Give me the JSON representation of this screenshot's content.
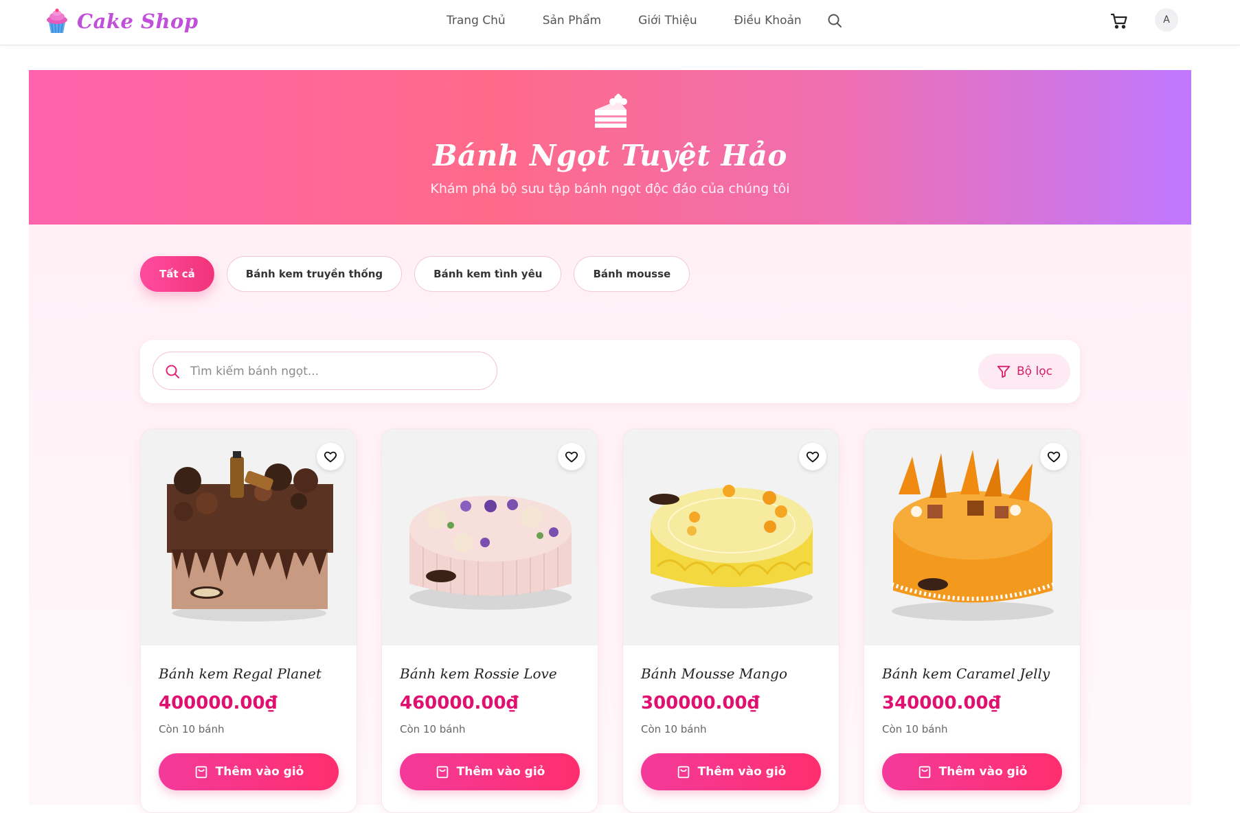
{
  "brand": {
    "name": "Cake Shop"
  },
  "nav": {
    "items": [
      {
        "label": "Trang Chủ"
      },
      {
        "label": "Sản Phẩm"
      },
      {
        "label": "Giới Thiệu"
      },
      {
        "label": "Điều Khoản"
      }
    ],
    "search_icon": "search-icon",
    "cart_icon": "cart-icon",
    "avatar_initial": "A"
  },
  "hero": {
    "icon": "cake-slice-icon",
    "title": "Bánh Ngọt Tuyệt Hảo",
    "subtitle": "Khám phá bộ sưu tập bánh ngọt độc đáo của chúng tôi"
  },
  "categories": [
    {
      "label": "Tất cả",
      "active": true
    },
    {
      "label": "Bánh kem truyền thống",
      "active": false
    },
    {
      "label": "Bánh kem tình yêu",
      "active": false
    },
    {
      "label": "Bánh mousse",
      "active": false
    }
  ],
  "search": {
    "placeholder": "Tìm kiếm bánh ngọt...",
    "value": "",
    "filter_label": "Bộ lọc"
  },
  "products": [
    {
      "name": "Bánh kem Regal Planet",
      "price": "400000.00₫",
      "stock": "Còn 10 bánh",
      "add_label": "Thêm vào giỏ",
      "image": "chocolate-square-cake"
    },
    {
      "name": "Bánh kem Rossie Love",
      "price": "460000.00₫",
      "stock": "Còn 10 bánh",
      "add_label": "Thêm vào giỏ",
      "image": "pink-floral-cake"
    },
    {
      "name": "Bánh Mousse Mango",
      "price": "300000.00₫",
      "stock": "Còn 10 bánh",
      "add_label": "Thêm vào giỏ",
      "image": "yellow-mango-mousse"
    },
    {
      "name": "Bánh kem Caramel Jelly",
      "price": "340000.00₫",
      "stock": "Còn 10 bánh",
      "add_label": "Thêm vào giỏ",
      "image": "orange-caramel-cake"
    }
  ],
  "colors": {
    "brand": "#c04fd9",
    "accent": "#e0106f",
    "button_gradient_start": "#f33a9b",
    "button_gradient_end": "#ff2e6e"
  }
}
